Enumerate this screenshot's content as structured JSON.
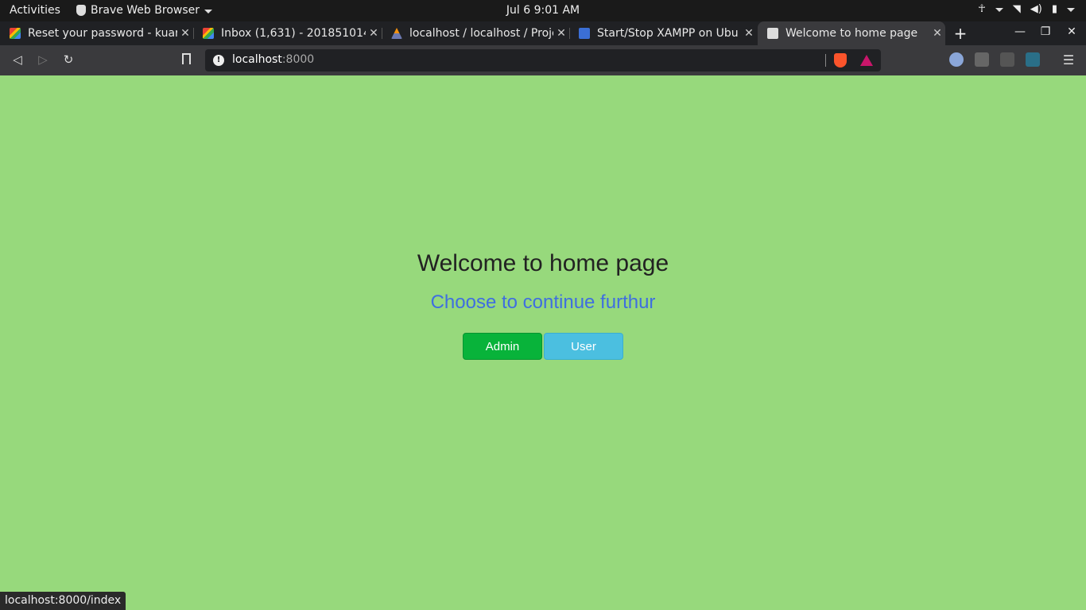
{
  "system_bar": {
    "activities": "Activities",
    "app_name": "Brave Web Browser",
    "clock": "Jul 6  9:01 AM"
  },
  "tabs": [
    {
      "title": "Reset your password - kuar",
      "favicon": "gmail-icon"
    },
    {
      "title": "Inbox (1,631) - 201851014@",
      "favicon": "gmail-icon"
    },
    {
      "title": "localhost / localhost / Proje",
      "favicon": "phpmyadmin-icon"
    },
    {
      "title": "Start/Stop XAMPP on Ubu",
      "favicon": "shield-icon"
    },
    {
      "title": "Welcome to home page",
      "favicon": "globe-icon",
      "active": true
    }
  ],
  "toolbar": {
    "url_host": "localhost",
    "url_port": ":8000"
  },
  "page": {
    "heading": "Welcome to home page",
    "subheading": "Choose to continue furthur",
    "admin_button": "Admin",
    "user_button": "User"
  },
  "status_url": "localhost:8000/index",
  "colors": {
    "page_background": "#97d97c",
    "heading_color": "#222222",
    "subheading_color": "#3f6ee0",
    "admin_button": "#08b33a",
    "user_button": "#4bbfe0"
  }
}
